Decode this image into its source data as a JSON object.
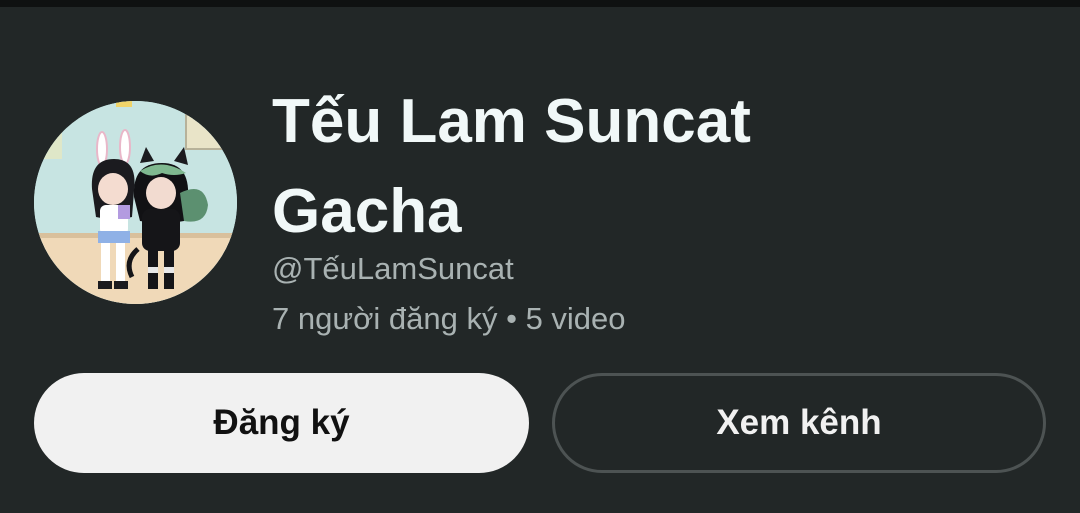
{
  "channel": {
    "name": "Tếu Lam Suncat Gacha",
    "handle": "@TếuLamSuncat",
    "stats": "7 người đăng ký • 5 video"
  },
  "actions": {
    "subscribe_label": "Đăng ký",
    "view_channel_label": "Xem kênh"
  },
  "colors": {
    "background": "#222727",
    "name_text": "#f1f8f8",
    "secondary_text": "#a9b2b2",
    "subscribe_bg": "#f1f1f1",
    "outline": "#4d5353"
  }
}
